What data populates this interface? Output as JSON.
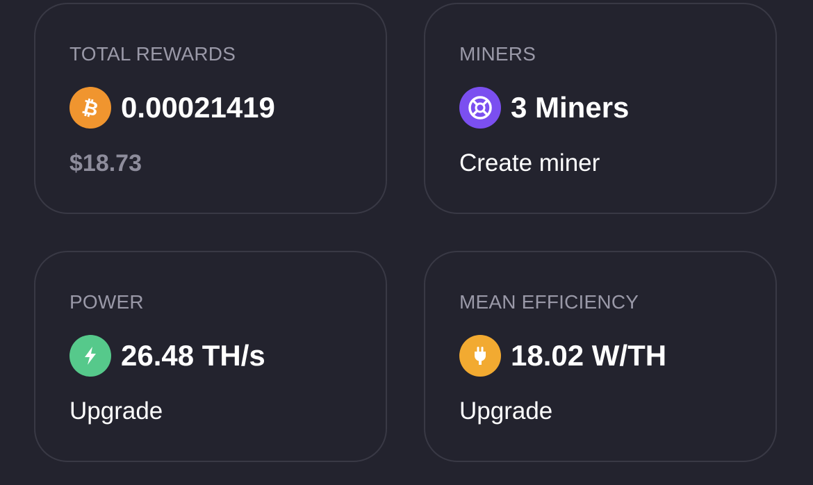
{
  "cards": {
    "rewards": {
      "label": "TOTAL REWARDS",
      "value": "0.00021419",
      "fiat": "$18.73",
      "icon": "bitcoin-icon",
      "icon_color": "#f0952f"
    },
    "miners": {
      "label": "MINERS",
      "value": "3 Miners",
      "action": "Create miner",
      "icon": "miner-network-icon",
      "icon_color": "#7b4ff0"
    },
    "power": {
      "label": "POWER",
      "value": "26.48 TH/s",
      "action": "Upgrade",
      "icon": "lightning-icon",
      "icon_color": "#56c98b"
    },
    "efficiency": {
      "label": "MEAN EFFICIENCY",
      "value": "18.02 W/TH",
      "action": "Upgrade",
      "icon": "power-plug-icon",
      "icon_color": "#f2aa31"
    }
  }
}
